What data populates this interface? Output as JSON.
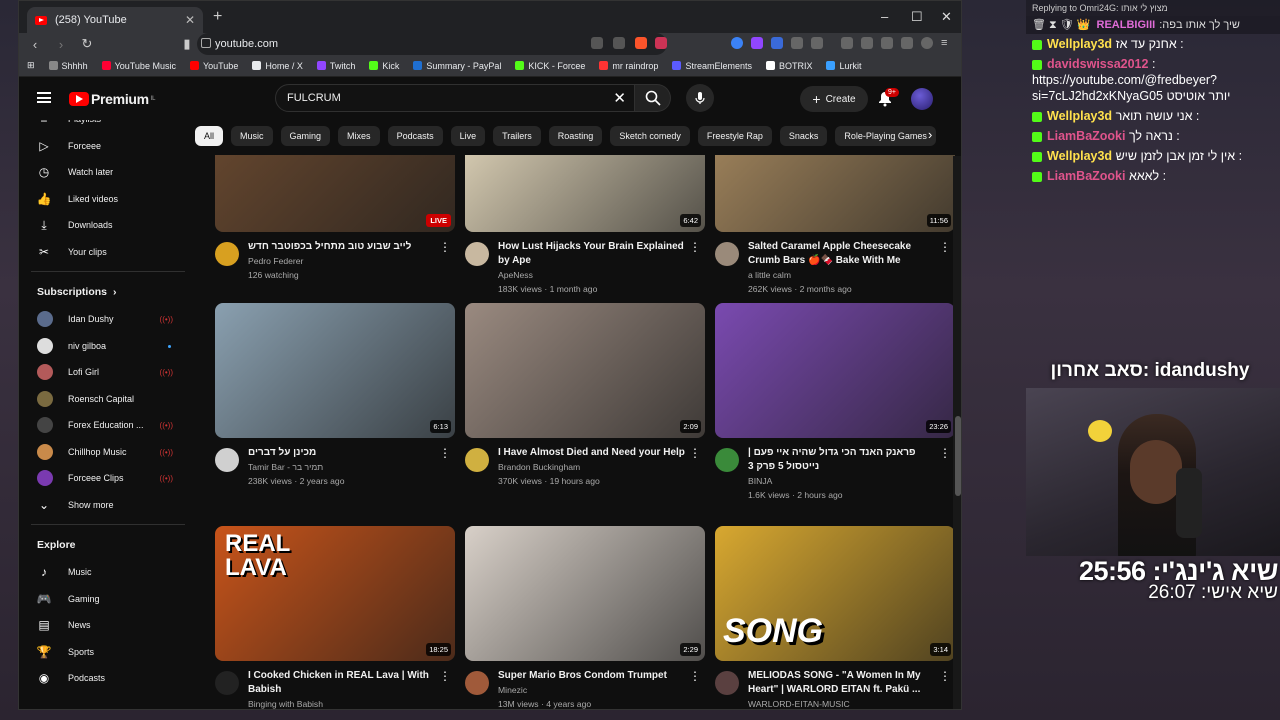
{
  "browser": {
    "tab_title": "(258) YouTube",
    "url": "youtube.com",
    "bookmarks": [
      {
        "label": "Shhhh",
        "color": "#888888"
      },
      {
        "label": "YouTube Music",
        "color": "#ff0033"
      },
      {
        "label": "YouTube",
        "color": "#ff0000"
      },
      {
        "label": "Home / X",
        "color": "#e8eaed"
      },
      {
        "label": "Twitch",
        "color": "#9146ff"
      },
      {
        "label": "Kick",
        "color": "#53fc18"
      },
      {
        "label": "Summary - PayPal",
        "color": "#1f6fd1"
      },
      {
        "label": "KICK - Forcee",
        "color": "#53fc18"
      },
      {
        "label": "mr raindrop",
        "color": "#ff3333"
      },
      {
        "label": "StreamElements",
        "color": "#5b5bff"
      },
      {
        "label": "BOTRIX",
        "color": "#ffffff"
      },
      {
        "label": "Lurkit",
        "color": "#3aa0ff"
      }
    ]
  },
  "youtube": {
    "logo_text": "Premium",
    "logo_region": "IL",
    "search_value": "FULCRUM",
    "create_label": "Create",
    "notif_badge": "9+",
    "sidebar": {
      "top_items": [
        {
          "label": "Playlists",
          "icon": "playlist-icon"
        },
        {
          "label": "Forceee",
          "icon": "play-icon"
        },
        {
          "label": "Watch later",
          "icon": "clock-icon"
        },
        {
          "label": "Liked videos",
          "icon": "thumbs-up-icon"
        },
        {
          "label": "Downloads",
          "icon": "download-icon"
        },
        {
          "label": "Your clips",
          "icon": "scissors-icon"
        }
      ],
      "subscriptions_header": "Subscriptions",
      "subscriptions": [
        {
          "label": "Idan Dushy",
          "status": "live",
          "color": "#5a6b8c"
        },
        {
          "label": "niv gilboa",
          "status": "new",
          "color": "#dddddd"
        },
        {
          "label": "Lofi Girl",
          "status": "live",
          "color": "#b35a5a"
        },
        {
          "label": "Roensch Capital",
          "status": "",
          "color": "#7a6a40"
        },
        {
          "label": "Forex Education ...",
          "status": "live",
          "color": "#444444"
        },
        {
          "label": "Chillhop Music",
          "status": "live",
          "color": "#c98a4a"
        },
        {
          "label": "Forceee Clips",
          "status": "live",
          "color": "#7a3ab0"
        }
      ],
      "show_more": "Show more",
      "explore_header": "Explore",
      "explore": [
        {
          "label": "Music",
          "icon": "music-note-icon"
        },
        {
          "label": "Gaming",
          "icon": "gamepad-icon"
        },
        {
          "label": "News",
          "icon": "newspaper-icon"
        },
        {
          "label": "Sports",
          "icon": "trophy-icon"
        },
        {
          "label": "Podcasts",
          "icon": "podcast-icon"
        }
      ]
    },
    "chips": [
      "All",
      "Music",
      "Gaming",
      "Mixes",
      "Podcasts",
      "Live",
      "Trailers",
      "Roasting",
      "Sketch comedy",
      "Freestyle Rap",
      "Snacks",
      "Role-Playing Games"
    ],
    "videos": [
      {
        "title": "לייב שבוע טוב מתחיל בכפוטבר חדש",
        "channel": "Pedro Federer",
        "stats": "126 watching",
        "badge": "LIVE",
        "thumb": "#6b4a30",
        "avatar": "#d8a020"
      },
      {
        "title": "How Lust Hijacks Your Brain Explained by Ape",
        "channel": "ApeNess",
        "stats": "183K views · 1 month ago",
        "badge": "6:42",
        "thumb": "#e8dcc0",
        "avatar": "#c8b8a0"
      },
      {
        "title": "Salted Caramel Apple Cheesecake Crumb Bars 🍎🍫 Bake With Me",
        "channel": "a little calm",
        "stats": "262K views · 2 months ago",
        "badge": "11:56",
        "thumb": "#a88a60",
        "avatar": "#9a8a7a"
      },
      {
        "title": "מכינן על דברים",
        "channel": "Tamir Bar - תמיר בר",
        "stats": "238K views · 2 years ago",
        "badge": "6:13",
        "thumb": "#8aa0b0",
        "avatar": "#d0d0d0"
      },
      {
        "title": "I Have Almost Died and Need your Help",
        "channel": "Brandon Buckingham",
        "stats": "370K views · 19 hours ago",
        "badge": "2:09",
        "thumb": "#9a8a80",
        "avatar": "#d0b040"
      },
      {
        "title": "פראנק האנד הכי גדול שהיה איי פעם | נייטסול 5 פרק 3",
        "channel": "BINJA",
        "stats": "1.6K views · 2 hours ago",
        "badge": "23:26",
        "thumb": "#7a4ab0",
        "avatar": "#3a8a3a"
      },
      {
        "title": "I Cooked Chicken in REAL Lava | With Babish",
        "channel": "Binging with Babish",
        "stats": "",
        "badge": "18:25",
        "thumb": "#c8541a",
        "avatar": "#222222"
      },
      {
        "title": "Super Mario Bros Condom Trumpet",
        "channel": "Minezic",
        "stats": "13M views · 4 years ago",
        "badge": "2:29",
        "thumb": "#d8d0c8",
        "avatar": "#a05a3a"
      },
      {
        "title": "MELIODAS SONG - \"A Women In My Heart\" | WARLORD EITAN ft. Pakü ...",
        "channel": "WARLORD-EITAN-MUSIC",
        "stats": "",
        "badge": "3:14",
        "thumb": "#d8a830",
        "avatar": "#5a4040"
      }
    ],
    "thumb_texts": {
      "lava": "REAL LAVA",
      "song": "SONG"
    }
  },
  "chat": {
    "reply": "Replying to Omri24G: מצוץ לי אותו",
    "pinned_user": "REALBIGIII",
    "pinned_text": ":שיך לך אותו בפה",
    "messages": [
      {
        "user": "Wellplay3d",
        "text": "אחנק עד אז :",
        "color": "u1"
      },
      {
        "user": "davidswissa2012",
        "text": ": https://youtube.com/@fredbeyer?si=7cLJ2hd2xKNyaG05 יותר אוטיסט",
        "color": "u2"
      },
      {
        "user": "Wellplay3d",
        "text": "אני עושה תואר :",
        "color": "u1"
      },
      {
        "user": "LiamBaZooki",
        "text": "נראה לך :",
        "color": "u2"
      },
      {
        "user": "Wellplay3d",
        "text": "אין לי זמן אבן לזמן שיש :",
        "color": "u1"
      },
      {
        "user": "LiamBaZooki",
        "text": "לאאא :",
        "color": "u2"
      }
    ]
  },
  "stream": {
    "last_sub": "סאב אחרון: idandushy",
    "record_timer": "שיא ג'ינג'י: 25:56",
    "personal_timer": "שיא אישי: 26:07"
  }
}
